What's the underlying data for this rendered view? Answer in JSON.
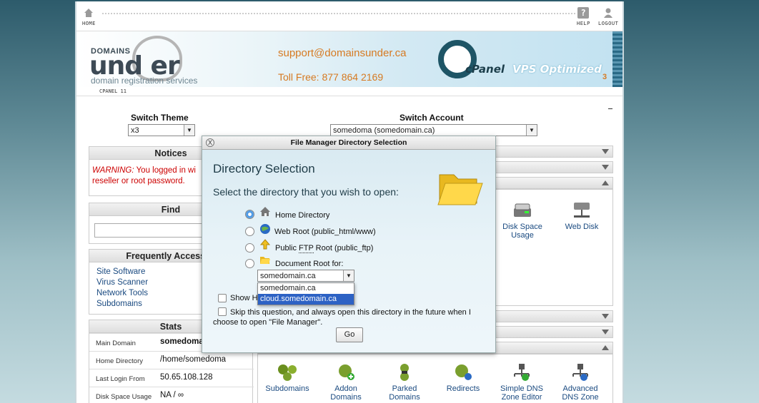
{
  "topbar": {
    "home": "HOME",
    "help": "HELP",
    "logout": "LOGOUT"
  },
  "banner": {
    "logo_top": "DOMAINS",
    "logo_main": "und  er",
    "logo_sub": "domain registration services",
    "support_email": "support@domainsunder.ca",
    "toll_free": "Toll Free: 877 864 2169",
    "cpanel": "cPanel",
    "vps": "VPS Optimized",
    "vps_num": "3"
  },
  "version": "CPANEL 11",
  "switch": {
    "theme_label": "Switch Theme",
    "theme_value": "x3",
    "account_label": "Switch Account",
    "account_value": "somedoma (somedomain.ca)"
  },
  "notices": {
    "title": "Notices",
    "warning_prefix": "WARNING:",
    "warning_line1": " You logged in wi",
    "warning_line2": "reseller or root password."
  },
  "find": {
    "title": "Find"
  },
  "frequent": {
    "title": "Frequently Accessed",
    "items": [
      "Site Software",
      "Virus Scanner",
      "Network Tools",
      "Subdomains"
    ]
  },
  "stats": {
    "title": "Stats",
    "rows": [
      {
        "key": "Main Domain",
        "value": "somedoma"
      },
      {
        "key": "Home Directory",
        "value": "/home/somedoma"
      },
      {
        "key": "Last Login From",
        "value": "50.65.108.128"
      },
      {
        "key": "Disk Space Usage",
        "value": "NA / ∞"
      }
    ]
  },
  "files_apps": [
    {
      "label1": "Disk Space",
      "label2": "Usage"
    },
    {
      "label1": "Web Disk",
      "label2": ""
    }
  ],
  "domain_apps": [
    {
      "label1": "Subdomains",
      "label2": ""
    },
    {
      "label1": "Addon",
      "label2": "Domains"
    },
    {
      "label1": "Parked",
      "label2": "Domains"
    },
    {
      "label1": "Redirects",
      "label2": ""
    },
    {
      "label1": "Simple DNS",
      "label2": "Zone Editor"
    },
    {
      "label1": "Advanced",
      "label2": "DNS Zone"
    }
  ],
  "dialog": {
    "title": "File Manager Directory Selection",
    "close": "X",
    "heading": "Directory Selection",
    "subheading": "Select the directory that you wish to open:",
    "options": [
      "Home Directory",
      "Web Root (public_html/www)",
      "Public ",
      "FTP",
      " Root (public_ftp)",
      "Document Root for:"
    ],
    "docroot_value": "somedomain.ca",
    "dropdown_options": [
      "somedomain.ca",
      "cloud.somedomain.ca"
    ],
    "show_hidden": "Show H",
    "skip_line1": "Skip this question, and always open this directory in the future when I",
    "skip_line2": "choose to open \"File Manager\".",
    "go": "Go"
  },
  "colors": {
    "accent_orange": "#d67a22",
    "link_blue": "#1a4a80",
    "warning_red": "#cc0000",
    "select_highlight": "#2d62c4"
  }
}
